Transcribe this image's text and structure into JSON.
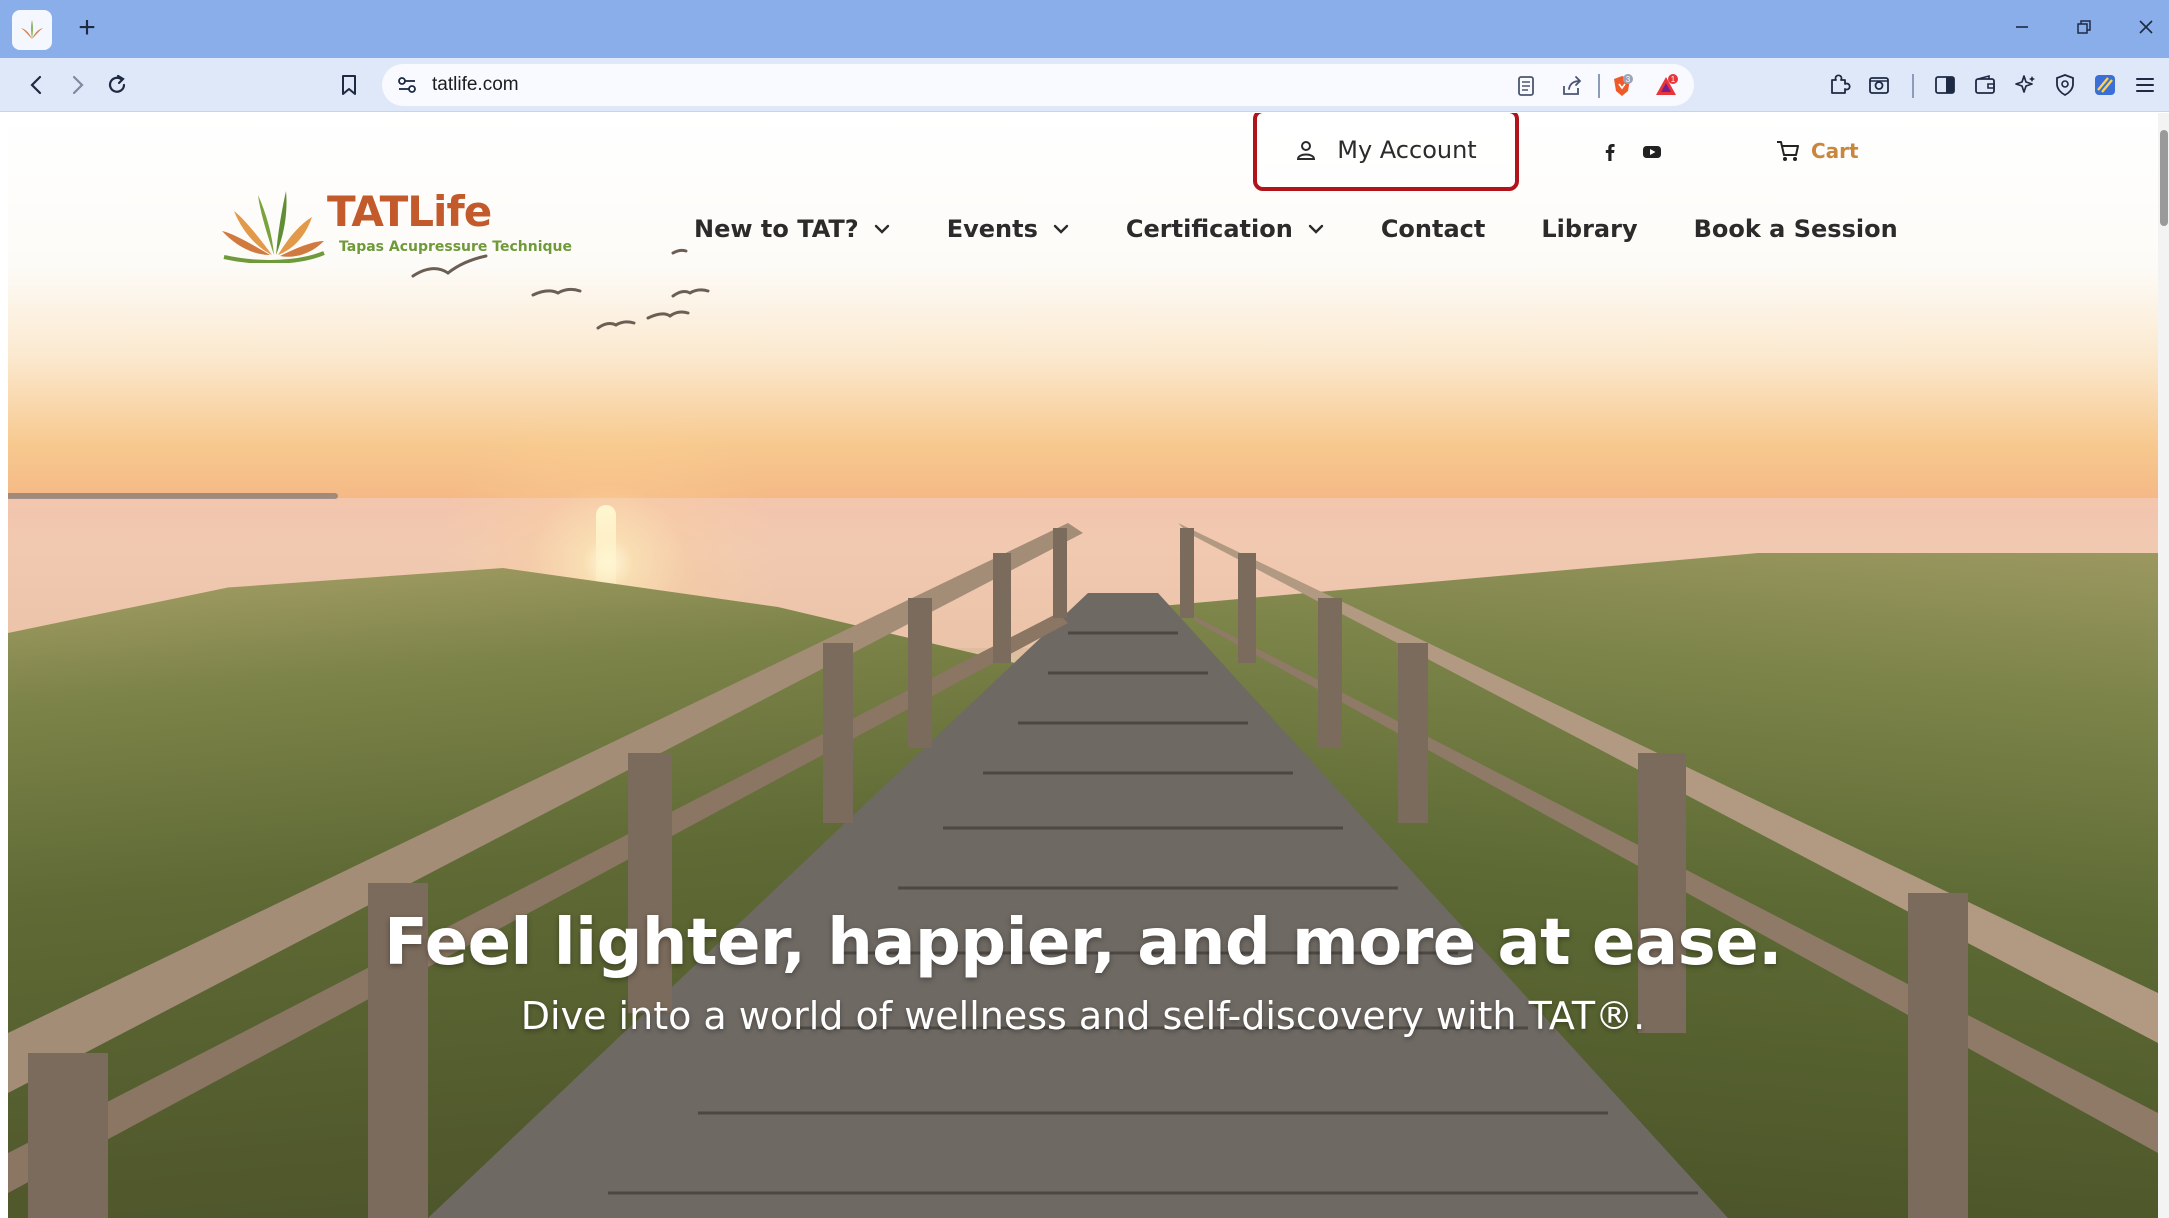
{
  "browser": {
    "new_tab": "+",
    "address": "tatlife.com",
    "window_controls": [
      "minimize",
      "restore",
      "close"
    ],
    "shields_badge": "3",
    "rewards_badge": "1"
  },
  "site": {
    "account_label": "My Account",
    "cart_label": "Cart",
    "logo_title": "TATLife",
    "logo_subtitle": "Tapas Acupressure Technique",
    "nav": [
      {
        "label": "New to TAT?",
        "dropdown": true
      },
      {
        "label": "Events",
        "dropdown": true
      },
      {
        "label": "Certification",
        "dropdown": true
      },
      {
        "label": "Contact",
        "dropdown": false
      },
      {
        "label": "Library",
        "dropdown": false
      },
      {
        "label": "Book a Session",
        "dropdown": false
      }
    ],
    "hero_title": "Feel lighter, happier, and more at ease.",
    "hero_subtitle": "Dive into a world of wellness and self-discovery with TAT®."
  },
  "colors": {
    "highlight_border": "#b0141a",
    "logo_orange": "#c35a2b",
    "logo_green": "#6f9a3a",
    "cart_orange": "#c9873e",
    "titlebar": "#89aeea"
  }
}
